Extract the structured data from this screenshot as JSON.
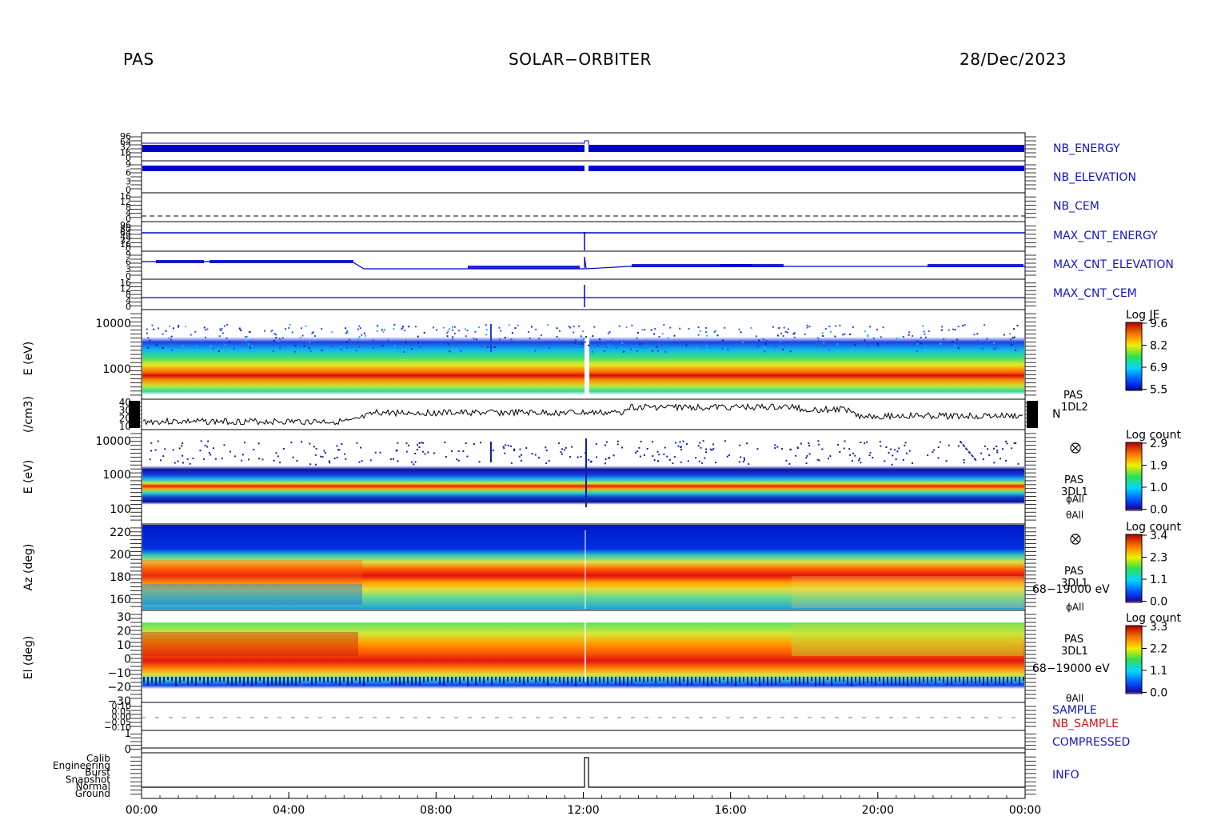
{
  "header": {
    "instrument": "PAS",
    "mission": "SOLAR−ORBITER",
    "date": "28/Dec/2023"
  },
  "colors": {
    "blue_label": "#1414c8",
    "red_label": "#d21414",
    "trace_blue": "#0000cc"
  },
  "chart_data": [
    {
      "type": "line",
      "title": "",
      "right_label": "NB_ENERGY",
      "ytick_labels": [
        "96",
        "64",
        "32",
        "16",
        "0"
      ],
      "x": [
        "00:00",
        "04:00",
        "08:00",
        "12:00",
        "16:00",
        "20:00",
        "00:00"
      ],
      "series": [
        {
          "values_desc": "dense block, constant until 12:05 then shifted"
        }
      ]
    },
    {
      "type": "line",
      "right_label": "NB_ELEVATION",
      "ytick_labels": [
        "9",
        "6",
        "3",
        "0"
      ]
    },
    {
      "type": "line",
      "right_label": "NB_CEM",
      "ytick_labels": [
        "16",
        "12",
        "8",
        "4",
        "0"
      ]
    },
    {
      "type": "line",
      "right_label": "MAX_CNT_ENERGY",
      "ytick_labels": [
        "96",
        "80",
        "64",
        "48",
        "32",
        "16",
        "0"
      ]
    },
    {
      "type": "line",
      "right_label": "MAX_CNT_ELEVATION",
      "ytick_labels": [
        "9",
        "6",
        "3",
        "0"
      ]
    },
    {
      "type": "line",
      "right_label": "MAX_CNT_CEM",
      "ytick_labels": [
        "16",
        "12",
        "8",
        "4",
        "0"
      ]
    },
    {
      "type": "heatmap",
      "ylabel": "E (eV)",
      "yticks": [
        "10000",
        "1000"
      ],
      "colorbar_title": "Log JE",
      "colorbar_ticks": [
        "9.6",
        "8.2",
        "6.9",
        "5.5"
      ],
      "right_labels": []
    },
    {
      "type": "line",
      "ylabel": "(/cm3)",
      "yticks": [
        "40",
        "30",
        "20",
        "10"
      ],
      "right_labels": [
        "PAS",
        "1DL2"
      ],
      "series_name": "N"
    },
    {
      "type": "heatmap",
      "ylabel": "E (eV)",
      "yticks": [
        "10000",
        "1000",
        "100"
      ],
      "colorbar_title": "Log count",
      "colorbar_ticks": [
        "2.9",
        "1.9",
        "1.0",
        "0.0"
      ],
      "right_labels": [
        "PAS",
        "3DL1",
        "ϕAll",
        "θAll"
      ]
    },
    {
      "type": "heatmap",
      "ylabel": "Az (deg)",
      "yticks": [
        "220",
        "200",
        "180",
        "160"
      ],
      "colorbar_title": "Log count",
      "colorbar_ticks": [
        "3.4",
        "2.3",
        "1.1",
        "0.0"
      ],
      "right_labels": [
        "PAS",
        "3DL1",
        "68−19000 eV",
        "ϕAll"
      ]
    },
    {
      "type": "heatmap",
      "ylabel": "El (deg)",
      "yticks": [
        "30",
        "20",
        "10",
        "0",
        "−10",
        "−20",
        "−30"
      ],
      "colorbar_title": "Log count",
      "colorbar_ticks": [
        "3.3",
        "2.2",
        "1.1",
        "0.0"
      ],
      "right_labels": [
        "PAS",
        "3DL1",
        "68−19000 eV",
        "θAll"
      ]
    },
    {
      "type": "line",
      "right_labels": [
        "SAMPLE",
        "NB_SAMPLE"
      ],
      "ytick_labels": [
        "0.10",
        "0.05",
        "0.00",
        "−0.05",
        "−0.10"
      ]
    },
    {
      "type": "line",
      "right_label": "COMPRESSED",
      "ytick_labels": [
        "1",
        "0"
      ]
    },
    {
      "type": "line",
      "right_label": "INFO",
      "ytick_labels": [
        "Calib",
        "Engineering",
        "Burst",
        "Snapshot",
        "Normal",
        "Ground"
      ]
    }
  ],
  "x_axis": {
    "ticks": [
      "00:00",
      "04:00",
      "08:00",
      "12:00",
      "16:00",
      "20:00",
      "00:00"
    ]
  }
}
